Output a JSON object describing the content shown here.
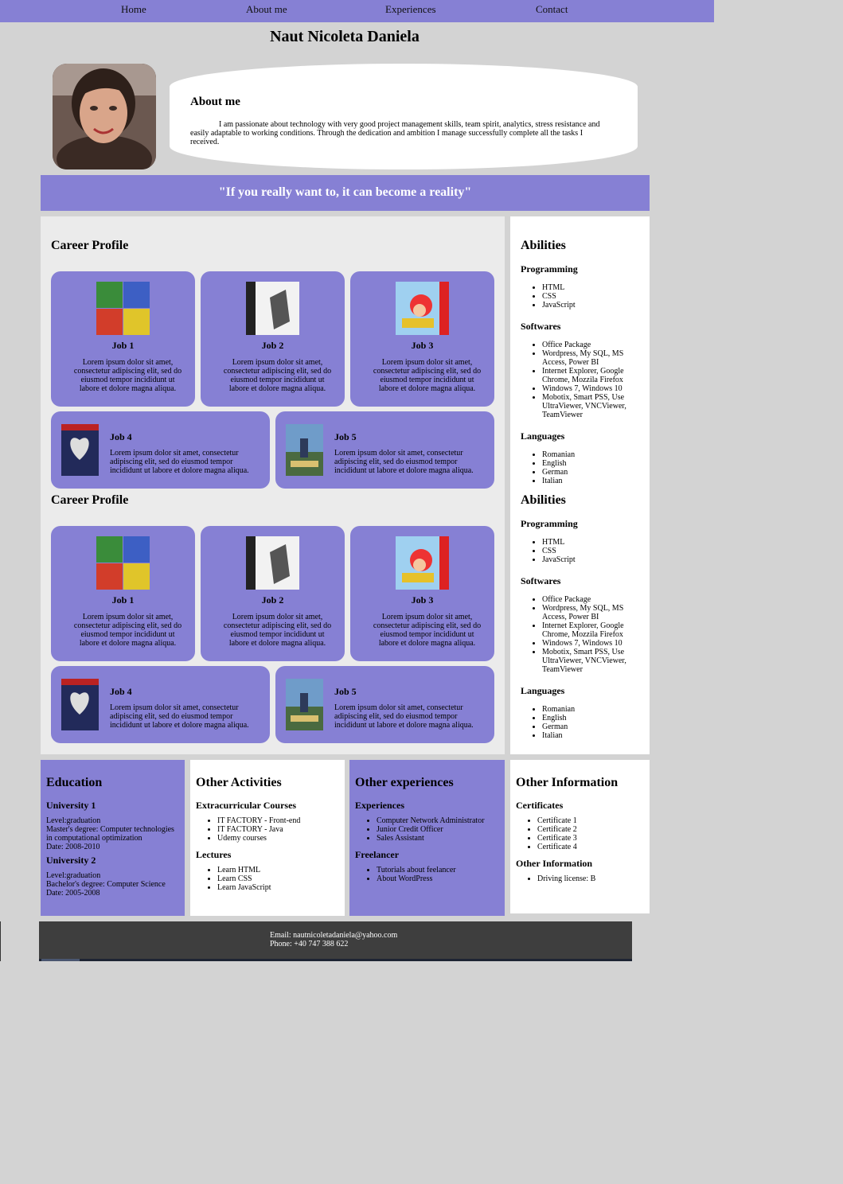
{
  "nav": [
    "Home",
    "About me",
    "Experiences",
    "Contact"
  ],
  "name": "Naut Nicoleta Daniela",
  "about": {
    "heading": "About me",
    "text": "I am passionate about technology with very good project management skills, team spirit, analytics, stress resistance and easily adaptable to working conditions. Through the dedication and ambition I manage successfully complete all the tasks I received."
  },
  "quote": "\"If you really want to, it can become a reality\"",
  "career": {
    "heading": "Career Profile",
    "jobs": [
      {
        "title": "Job 1",
        "text": "Lorem ipsum dolor sit amet, consectetur adipiscing elit, sed do eiusmod tempor incididunt ut labore et dolore magna aliqua."
      },
      {
        "title": "Job 2",
        "text": "Lorem ipsum dolor sit amet, consectetur adipiscing elit, sed do eiusmod tempor incididunt ut labore et dolore magna aliqua."
      },
      {
        "title": "Job 3",
        "text": "Lorem ipsum dolor sit amet, consectetur adipiscing elit, sed do eiusmod tempor incididunt ut labore et dolore magna aliqua."
      },
      {
        "title": "Job 4",
        "text": "Lorem ipsum dolor sit amet, consectetur adipiscing elit, sed do eiusmod tempor incididunt ut labore et dolore magna aliqua."
      },
      {
        "title": "Job 5",
        "text": "Lorem ipsum dolor sit amet, consectetur adipiscing elit, sed do eiusmod tempor incididunt ut labore et dolore magna aliqua."
      }
    ]
  },
  "abilities": {
    "heading": "Abilities",
    "programming": {
      "title": "Programming",
      "items": [
        "HTML",
        "CSS",
        "JavaScript"
      ]
    },
    "softwares": {
      "title": "Softwares",
      "items": [
        "Office Package",
        "Wordpress, My SQL, MS Access, Power BI",
        "Internet Explorer, Google Chrome, Mozzila Firefox",
        "Windows 7, Windows 10",
        "Mobotix, Smart PSS, Use UltraViewer, VNCViewer, TeamViewer"
      ]
    },
    "languages": {
      "title": "Languages",
      "items": [
        "Romanian",
        "English",
        "German",
        "Italian"
      ]
    }
  },
  "education": {
    "heading": "Education",
    "u1": {
      "title": "University 1",
      "lines": [
        "Level:graduation",
        "Master's degree: Computer technologies in computational optimization",
        "Date: 2008-2010"
      ]
    },
    "u2": {
      "title": "University 2",
      "lines": [
        "Level:graduation",
        "Bachelor's degree: Computer Science",
        "Date: 2005-2008"
      ]
    }
  },
  "activities": {
    "heading": "Other Activities",
    "courses": {
      "title": "Extracurricular Courses",
      "items": [
        "IT FACTORY - Front-end",
        "IT FACTORY - Java",
        "Udemy courses"
      ]
    },
    "lectures": {
      "title": "Lectures",
      "items": [
        "Learn HTML",
        "Learn CSS",
        "Learn JavaScript"
      ]
    }
  },
  "experiences": {
    "heading": "Other experiences",
    "exp": {
      "title": "Experiences",
      "items": [
        "Computer Network Administrator",
        "Junior Credit Officer",
        "Sales Assistant"
      ]
    },
    "free": {
      "title": "Freelancer",
      "items": [
        "Tutorials about feelancer",
        "About WordPress"
      ]
    }
  },
  "info": {
    "heading": "Other Information",
    "certs": {
      "title": "Certificates",
      "items": [
        "Certificate 1",
        "Certificate 2",
        "Certificate 3",
        "Certificate 4"
      ]
    },
    "other": {
      "title": "Other Information",
      "items": [
        "Driving license: B"
      ]
    }
  },
  "footer": {
    "email": "Email: nautnicoletadaniela@yahoo.com",
    "phone": "Phone: +40 747 388 622"
  },
  "colors": {
    "accent": "#8680d4",
    "background": "#d3d3d3",
    "footer": "#3e3e3e"
  }
}
